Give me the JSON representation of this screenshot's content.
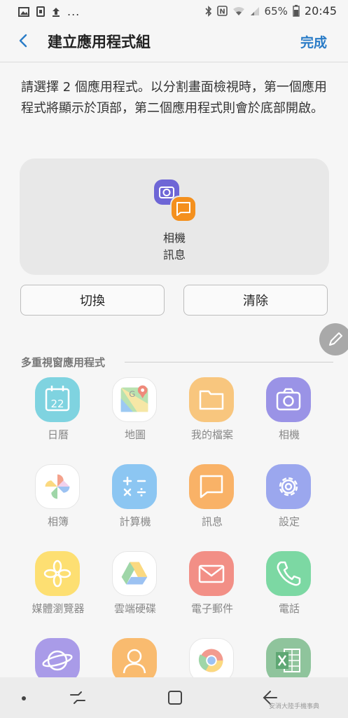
{
  "status": {
    "battery": "65%",
    "time": "20:45",
    "left_icons": [
      "image-icon",
      "sim-icon",
      "upload-icon",
      "more-icon"
    ],
    "right_icons": [
      "bluetooth-icon",
      "nfc-icon",
      "wifi-icon",
      "signal-icon",
      "battery-icon"
    ]
  },
  "header": {
    "title": "建立應用程式組",
    "done": "完成"
  },
  "instructions": "請選擇 2 個應用程式。以分割畫面檢視時，第一個應用程式將顯示於頂部，第二個應用程式則會於底部開啟。",
  "pair": {
    "first": "相機",
    "second": "訊息"
  },
  "buttons": {
    "swap": "切換",
    "clear": "清除"
  },
  "section": {
    "title": "多重視窗應用程式"
  },
  "apps": [
    {
      "label": "日曆",
      "icon": "calendar-icon",
      "color": "#7fd3e0",
      "date": "22"
    },
    {
      "label": "地圖",
      "icon": "maps-icon",
      "color": "#ffffff"
    },
    {
      "label": "我的檔案",
      "icon": "folder-icon",
      "color": "#f8c67e"
    },
    {
      "label": "相機",
      "icon": "camera-icon",
      "color": "#9a93e6"
    },
    {
      "label": "相簿",
      "icon": "photos-icon",
      "color": "#ffffff"
    },
    {
      "label": "計算機",
      "icon": "calculator-icon",
      "color": "#8cc6f2"
    },
    {
      "label": "訊息",
      "icon": "message-icon",
      "color": "#f9b267"
    },
    {
      "label": "設定",
      "icon": "gear-icon",
      "color": "#9ba7ee"
    },
    {
      "label": "媒體瀏覽器",
      "icon": "media-icon",
      "color": "#fddf72"
    },
    {
      "label": "雲端硬碟",
      "icon": "drive-icon",
      "color": "#ffffff"
    },
    {
      "label": "電子郵件",
      "icon": "mail-icon",
      "color": "#f28f86"
    },
    {
      "label": "電話",
      "icon": "phone-icon",
      "color": "#7cd8a3"
    },
    {
      "label": "",
      "icon": "internet-icon",
      "color": "#a99be8"
    },
    {
      "label": "",
      "icon": "contacts-icon",
      "color": "#f9bb6f"
    },
    {
      "label": "",
      "icon": "chrome-icon",
      "color": "#ffffff"
    },
    {
      "label": "",
      "icon": "excel-icon",
      "color": "#8fc49c"
    }
  ],
  "watermark": "安消大陸手機事典"
}
